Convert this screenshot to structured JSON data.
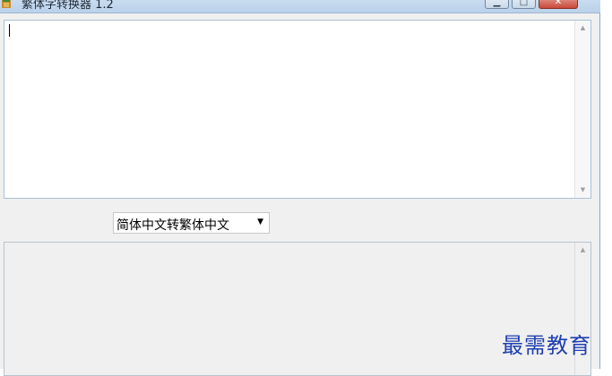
{
  "window": {
    "title": "繁体字转换器 1.2",
    "icon": "app-icon",
    "caption_buttons": {
      "minimize_glyph": "▁",
      "maximize_glyph": "□",
      "close_glyph": "✕"
    }
  },
  "input": {
    "value": ""
  },
  "converter": {
    "mode_selected": "简体中文转繁体中文",
    "dropdown_arrow": "▼"
  },
  "output": {
    "value": ""
  },
  "scrollbar": {
    "up_arrow": "▲",
    "down_arrow": "▼"
  },
  "watermark": {
    "text": "最需教育"
  },
  "colors": {
    "window_bg": "#f0f0f0",
    "titlebar": "#b9d1ea",
    "close_button": "#c8493a",
    "watermark": "#1f3fb0"
  }
}
